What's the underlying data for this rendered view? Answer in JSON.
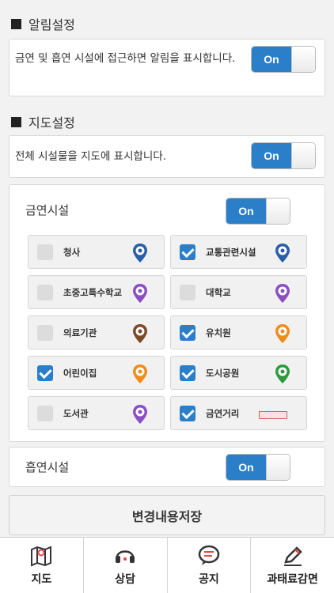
{
  "notification": {
    "title": "알림설정",
    "description": "금연 및 흡연 시설에 접근하면 알림을 표시합니다.",
    "toggle": "On"
  },
  "map": {
    "title": "지도설정",
    "description": "전체 시설물을 지도에 표시합니다.",
    "toggle": "On"
  },
  "no_smoking": {
    "label": "금연시설",
    "toggle": "On",
    "items": [
      {
        "label": "청사",
        "checked": false,
        "icon": "government-office-pin-icon",
        "color": "#2a5ea8"
      },
      {
        "label": "교통관련시설",
        "checked": true,
        "icon": "bus-pin-icon",
        "color": "#2a5ea8"
      },
      {
        "label": "초중고특수학교",
        "checked": false,
        "icon": "school-pin-icon",
        "color": "#8b4fc3"
      },
      {
        "label": "대학교",
        "checked": false,
        "icon": "graduation-cap-pin-icon",
        "color": "#8b4fc3"
      },
      {
        "label": "의료기관",
        "checked": false,
        "icon": "medical-pin-icon",
        "color": "#7b4a2a"
      },
      {
        "label": "유치원",
        "checked": true,
        "icon": "kindergarten-pin-icon",
        "color": "#f08c1a"
      },
      {
        "label": "어린이집",
        "checked": true,
        "icon": "daycare-pin-icon",
        "color": "#f08c1a"
      },
      {
        "label": "도시공원",
        "checked": true,
        "icon": "park-pin-icon",
        "color": "#2e9a3c"
      },
      {
        "label": "도서관",
        "checked": false,
        "icon": "library-pin-icon",
        "color": "#8b4fc3"
      },
      {
        "label": "금연거리",
        "checked": true,
        "icon": "no-smoking-street-strip-icon",
        "color": "#e25b5b"
      }
    ]
  },
  "smoking": {
    "label": "흡연시설",
    "toggle": "On"
  },
  "save_button": "변경내용저장",
  "tabs": [
    {
      "label": "지도",
      "icon": "map-icon"
    },
    {
      "label": "상담",
      "icon": "headset-icon"
    },
    {
      "label": "공지",
      "icon": "chat-bubble-icon"
    },
    {
      "label": "과태료감면",
      "icon": "pencil-icon"
    }
  ],
  "accent_color": "#2a7fc8"
}
